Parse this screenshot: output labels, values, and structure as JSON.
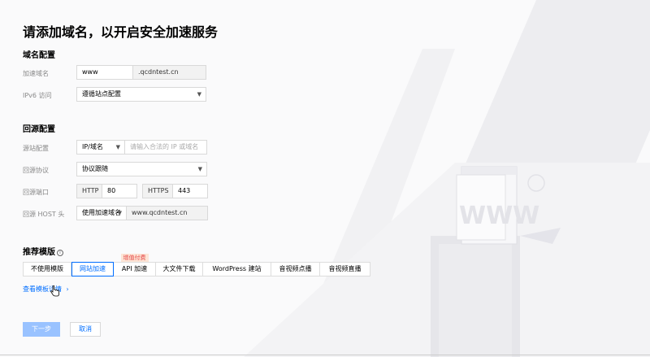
{
  "page_title": "请添加域名，以开启安全加速服务",
  "domain_config": {
    "heading": "域名配置",
    "domain_label": "加速域名",
    "domain_value": "www",
    "domain_suffix": ".qcdntest.cn",
    "ipv6_label": "IPv6 访问",
    "ipv6_value": "遵循站点配置"
  },
  "origin_config": {
    "heading": "回源配置",
    "origin_label": "源站配置",
    "origin_type": "IP/域名",
    "origin_placeholder": "请输入合法的 IP 或域名",
    "protocol_label": "回源协议",
    "protocol_value": "协议跟随",
    "port_label": "回源端口",
    "http_label": "HTTP",
    "http_port": "80",
    "https_label": "HTTPS",
    "https_port": "443",
    "host_label": "回源 HOST 头",
    "host_type": "使用加速域名",
    "host_value": "www.qcdntest.cn"
  },
  "templates": {
    "heading": "推荐模版",
    "info_glyph": "i",
    "items": [
      "不使用模版",
      "网站加速",
      "API 加速",
      "大文件下载",
      "WordPress 建站",
      "音视频点播",
      "音视频直播"
    ],
    "active_index": 1,
    "badge": "增值付费",
    "details_link": "查看模板详情"
  },
  "buttons": {
    "next": "下一步",
    "cancel": "取消"
  },
  "illustration_text": "WWW"
}
